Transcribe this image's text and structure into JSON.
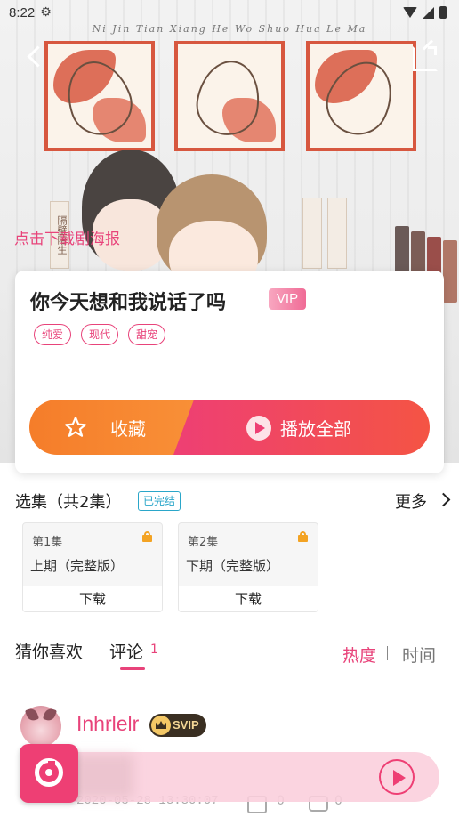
{
  "status_bar": {
    "time": "8:22"
  },
  "hero": {
    "script_text": "Ni Jin Tian Xiang He Wo Shuo Hua Le Ma",
    "banner_text": "隔壁陪生",
    "poster_hint": "点击下载剧海报"
  },
  "album": {
    "title": "你今天想和我说话了吗",
    "vip_label": "VIP",
    "tags": [
      "纯爱",
      "现代",
      "甜宠"
    ],
    "favorite_label": "收藏",
    "play_all_label": "播放全部"
  },
  "episodes": {
    "header": "选集（共2集）",
    "status_badge": "已完结",
    "more_label": "更多",
    "items": [
      {
        "number": "第1集",
        "name": "上期（完整版）",
        "download_label": "下载"
      },
      {
        "number": "第2集",
        "name": "下期（完整版）",
        "download_label": "下载"
      }
    ]
  },
  "tabs": {
    "guess": "猜你喜欢",
    "comments": "评论",
    "comment_count": "1",
    "sort_hot": "热度",
    "sort_time": "时间"
  },
  "comment": {
    "username": "Inhrlelr",
    "badge": "SVIP",
    "date": "2020-05-28 13:30:07",
    "likes": "0",
    "replies": "0"
  },
  "colors": {
    "accent": "#e8437a",
    "orange": "#f57d2a",
    "red": "#f45444",
    "teal_badge": "#2aa6c9",
    "lock": "#f3a323"
  },
  "icons": {
    "status": [
      "gear-icon",
      "wifi-icon",
      "signal-icon",
      "battery-icon"
    ],
    "nav": [
      "back-icon",
      "share-icon"
    ],
    "actions": [
      "star-icon",
      "play-circle-icon",
      "chevron-right-icon",
      "lock-icon",
      "like-icon",
      "reply-icon",
      "player-play-icon",
      "player-logo-icon"
    ]
  }
}
